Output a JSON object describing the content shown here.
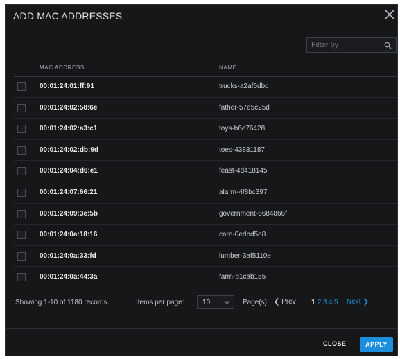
{
  "dialog": {
    "title": "ADD MAC ADDRESSES",
    "close_icon": "close-icon"
  },
  "filter": {
    "placeholder": "Filter by",
    "value": "",
    "icon": "search-icon"
  },
  "table": {
    "headers": {
      "mac": "MAC ADDRESS",
      "name": "NAME"
    },
    "rows": [
      {
        "mac": "00:01:24:01:ff:91",
        "name": "trucks-a2af6dbd"
      },
      {
        "mac": "00:01:24:02:58:6e",
        "name": "father-57e5c25d"
      },
      {
        "mac": "00:01:24:02:a3:c1",
        "name": "toys-b6e76428"
      },
      {
        "mac": "00:01:24:02:db:9d",
        "name": "toes-43831187"
      },
      {
        "mac": "00:01:24:04:d6:e1",
        "name": "feast-4d418145"
      },
      {
        "mac": "00:01:24:07:66:21",
        "name": "alarm-4f8bc397"
      },
      {
        "mac": "00:01:24:09:3e:5b",
        "name": "government-6684866f"
      },
      {
        "mac": "00:01:24:0a:18:16",
        "name": "care-0edbd5e8"
      },
      {
        "mac": "00:01:24:0a:33:fd",
        "name": "lumber-3af5110e"
      },
      {
        "mac": "00:01:24:0a:44:3a",
        "name": "farm-b1cab155"
      }
    ]
  },
  "pagination": {
    "showing": "Showing 1-10 of 1180 records.",
    "items_per_page_label": "Items per page:",
    "items_per_page": "10",
    "pages_label": "Page(s):",
    "prev": "Prev",
    "pages": [
      "1",
      "2",
      "3",
      "4",
      "5"
    ],
    "current_page": "1",
    "next": "Next"
  },
  "actions": {
    "close": "CLOSE",
    "apply": "APPLY"
  },
  "colors": {
    "background": "#151719",
    "accent": "#1b8fdd",
    "link": "#1f8ad6"
  }
}
